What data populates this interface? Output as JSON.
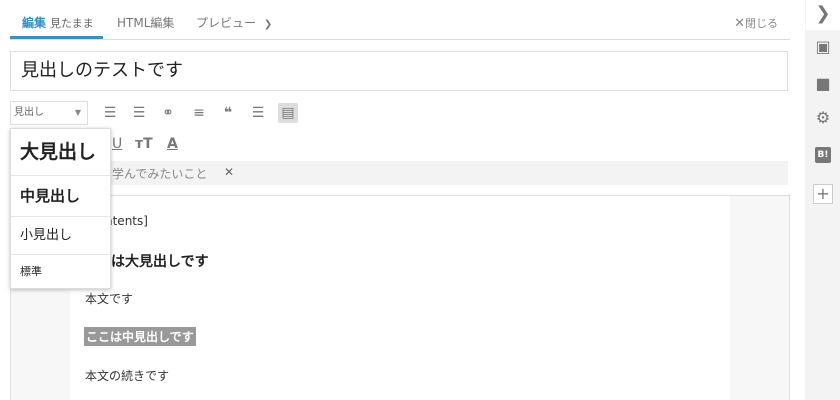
{
  "tabs": {
    "visual": {
      "label": "編集",
      "sub": "見たまま"
    },
    "html": "HTML編集",
    "preview": "プレビュー",
    "close": "閉じる"
  },
  "title": "見出しのテストです",
  "toolbar": {
    "heading_select": "見出し",
    "icons": [
      "bulleted-list",
      "numbered-list",
      "link",
      "more",
      "blockquote",
      "table-of-contents",
      "insert-template"
    ]
  },
  "dropdown": {
    "items": [
      "大見出し",
      "中見出し",
      "小見出し",
      "標準"
    ]
  },
  "tag": {
    "text": "ま学んでみたいこと"
  },
  "editor": {
    "line1": "ntents]",
    "heading1": "は大見出しです",
    "para1": "本文です",
    "heading2": "ここは中見出しです",
    "para2": "本文の続きです"
  },
  "colors": {
    "accent": "#3d8fbf",
    "sidebar_bg": "#f3f3f3",
    "heading_highlight": "#999999"
  }
}
